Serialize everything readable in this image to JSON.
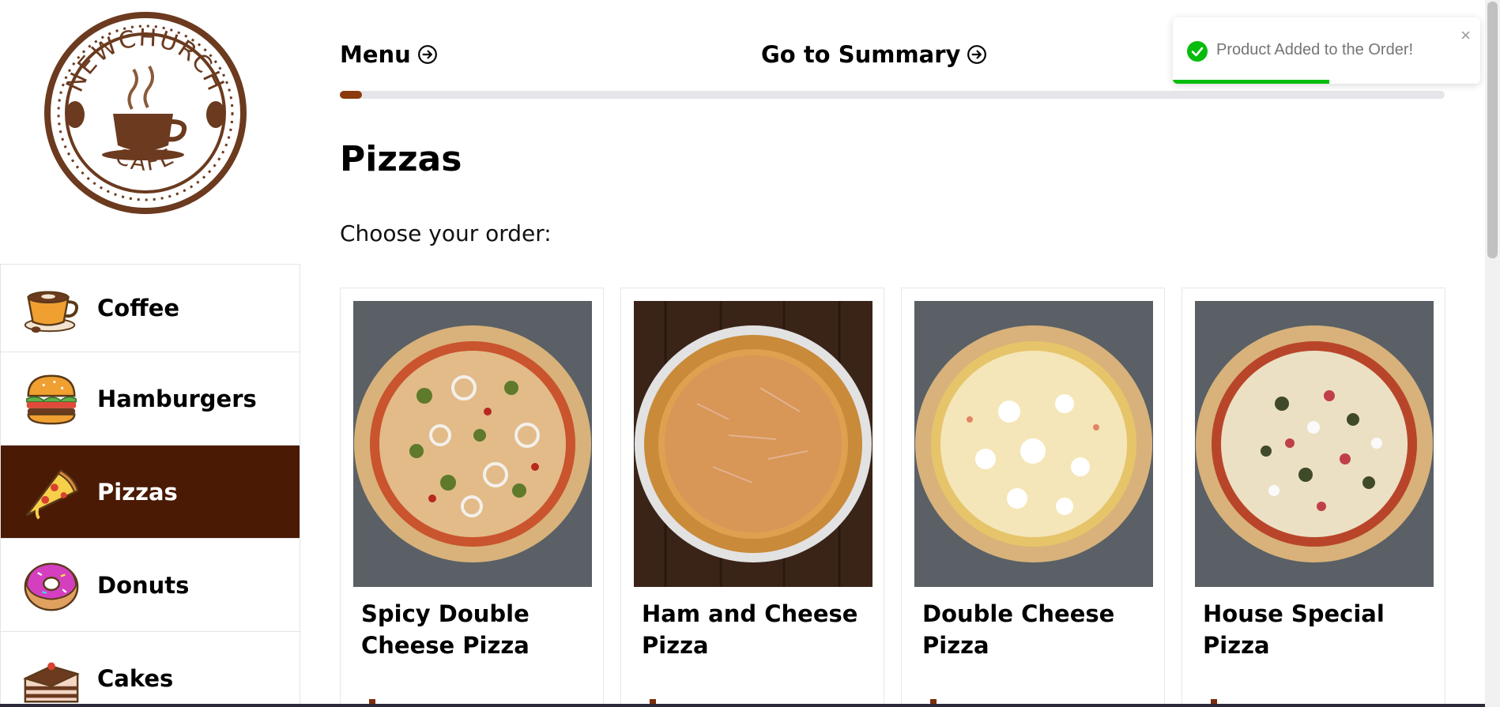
{
  "brand": {
    "logo_text_top": "NEWCHURCH",
    "logo_text_bottom": "CAFE"
  },
  "nav": {
    "menu_label": "Menu",
    "summary_label": "Go to Summary",
    "progress": 0.02
  },
  "sidebar": {
    "items": [
      {
        "label": "Coffee",
        "icon": "coffee-cup-icon",
        "active": false
      },
      {
        "label": "Hamburgers",
        "icon": "hamburger-icon",
        "active": false
      },
      {
        "label": "Pizzas",
        "icon": "pizza-slice-icon",
        "active": true
      },
      {
        "label": "Donuts",
        "icon": "donut-icon",
        "active": false
      },
      {
        "label": "Cakes",
        "icon": "cake-slice-icon",
        "active": false
      }
    ]
  },
  "main": {
    "title": "Pizzas",
    "subtitle": "Choose your order:",
    "products": [
      {
        "name": "Spicy Double Cheese Pizza",
        "image": "spicy-double-cheese-pizza-photo"
      },
      {
        "name": "Ham and Cheese Pizza",
        "image": "ham-and-cheese-pizza-photo"
      },
      {
        "name": "Double Cheese Pizza",
        "image": "double-cheese-pizza-photo"
      },
      {
        "name": "House Special Pizza",
        "image": "house-special-pizza-photo"
      }
    ]
  },
  "toast": {
    "message": "Product Added to the Order!",
    "close_label": "×",
    "remaining": 0.51,
    "color": "#07bc0c"
  },
  "colors": {
    "accent": "#4a1a05",
    "progress": "#8b3a0e",
    "logo": "#6b3a1f"
  }
}
